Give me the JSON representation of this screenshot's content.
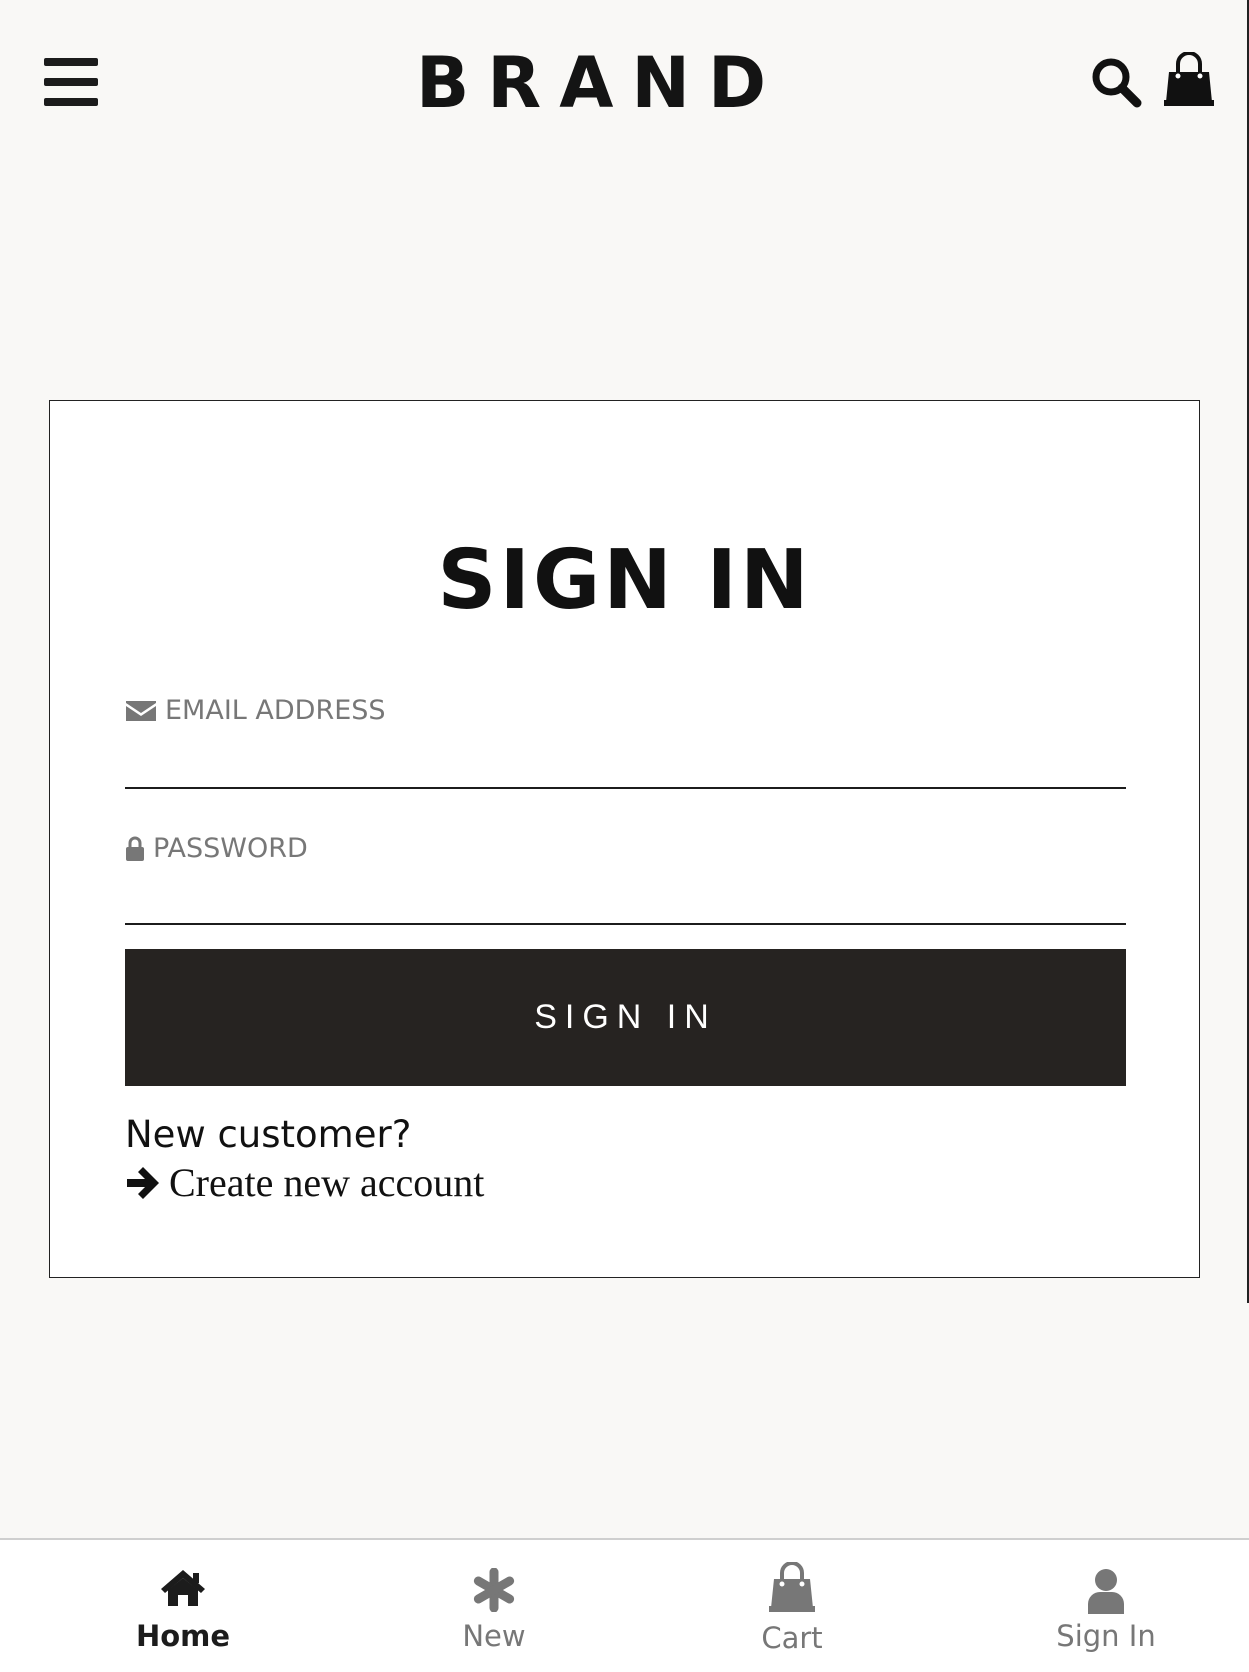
{
  "header": {
    "brand": "BRAND",
    "menu_icon": "hamburger-menu-icon",
    "search_icon": "search-icon",
    "cart_icon": "shopping-bag-icon"
  },
  "signin_card": {
    "title": "SIGN IN",
    "email": {
      "label": "EMAIL ADDRESS",
      "icon": "envelope-icon",
      "value": ""
    },
    "password": {
      "label": "PASSWORD",
      "icon": "lock-icon",
      "value": ""
    },
    "submit_label": "SIGN IN",
    "new_customer_text": "New customer?",
    "create_account_label": "Create new account",
    "create_account_icon": "arrow-right-icon"
  },
  "bottom_nav": {
    "items": [
      {
        "label": "Home",
        "icon": "home-icon",
        "active": true
      },
      {
        "label": "New",
        "icon": "asterisk-icon",
        "active": false
      },
      {
        "label": "Cart",
        "icon": "shopping-bag-icon",
        "active": false
      },
      {
        "label": "Sign In",
        "icon": "user-icon",
        "active": false
      }
    ]
  },
  "colors": {
    "page_background": "#f9f8f6",
    "card_background": "#ffffff",
    "primary_button": "#262321",
    "text_dark": "#111111",
    "text_muted": "#777777"
  }
}
